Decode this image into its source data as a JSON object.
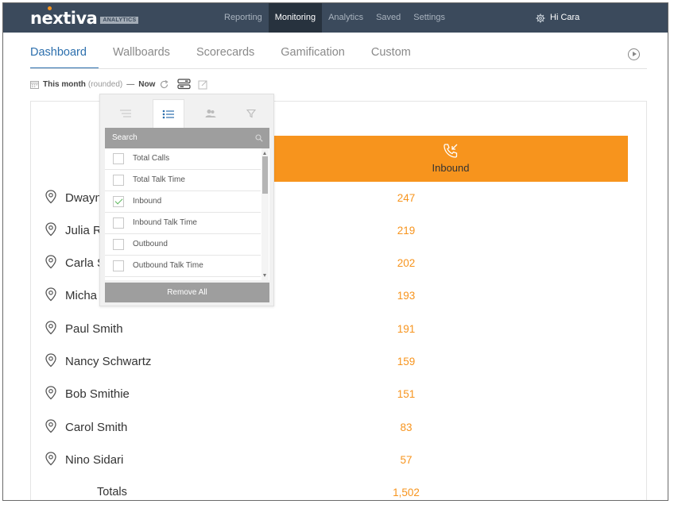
{
  "brand": {
    "logo_text": "nextiva",
    "logo_badge": "ANALYTICS",
    "accent": "#f7941d",
    "nav_bg": "#3b4a5c"
  },
  "topnav": {
    "items": [
      {
        "label": "Reporting",
        "active": false
      },
      {
        "label": "Monitoring",
        "active": true
      },
      {
        "label": "Analytics",
        "active": false
      },
      {
        "label": "Saved",
        "active": false
      },
      {
        "label": "Settings",
        "active": false
      }
    ],
    "user_label": "Hi Cara"
  },
  "tabs": [
    {
      "label": "Dashboard",
      "active": true
    },
    {
      "label": "Wallboards",
      "active": false
    },
    {
      "label": "Scorecards",
      "active": false
    },
    {
      "label": "Gamification",
      "active": false
    },
    {
      "label": "Custom",
      "active": false
    }
  ],
  "filters": {
    "period": "This month",
    "rounded": "(rounded)",
    "dash": "—",
    "end": "Now"
  },
  "column": {
    "label": "Inbound",
    "icon": "incoming-call-icon"
  },
  "rows": [
    {
      "name": "Dwayne",
      "value": "247"
    },
    {
      "name": "Julia R",
      "value": "219"
    },
    {
      "name": "Carla S",
      "value": "202"
    },
    {
      "name": "Micha",
      "value": "193"
    },
    {
      "name": "Paul Smith",
      "value": "191"
    },
    {
      "name": "Nancy Schwartz",
      "value": "159"
    },
    {
      "name": "Bob Smithie",
      "value": "151"
    },
    {
      "name": "Carol Smith",
      "value": "83"
    },
    {
      "name": "Nino Sidari",
      "value": "57"
    }
  ],
  "totals": {
    "label": "Totals",
    "value": "1,502"
  },
  "popover": {
    "search_placeholder": "Search",
    "items": [
      {
        "label": "Total Calls",
        "checked": false
      },
      {
        "label": "Total Talk Time",
        "checked": false
      },
      {
        "label": "Inbound",
        "checked": true
      },
      {
        "label": "Inbound Talk Time",
        "checked": false
      },
      {
        "label": "Outbound",
        "checked": false
      },
      {
        "label": "Outbound Talk Time",
        "checked": false
      }
    ],
    "remove_all_label": "Remove All"
  }
}
